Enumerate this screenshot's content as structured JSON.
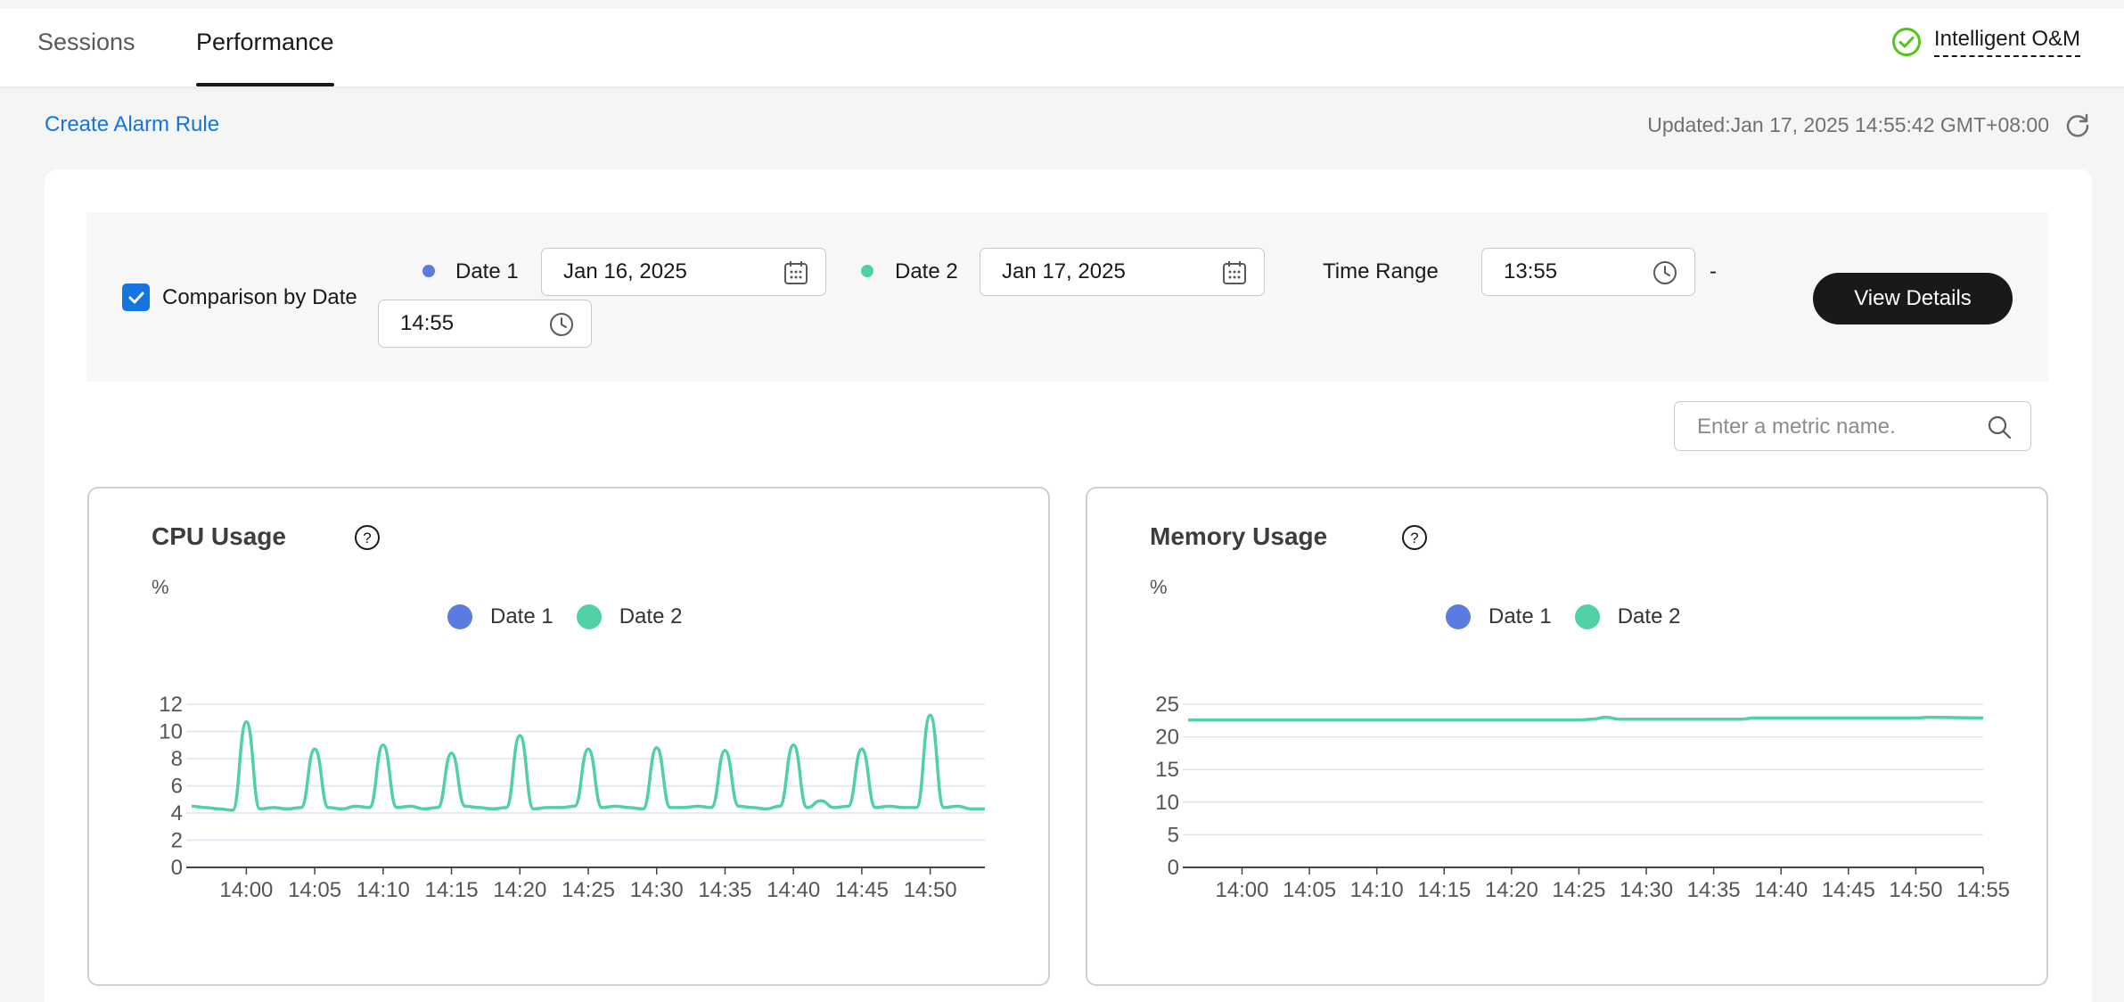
{
  "tabs": [
    {
      "label": "Sessions",
      "active": false
    },
    {
      "label": "Performance",
      "active": true
    }
  ],
  "om": {
    "label": "Intelligent O&M",
    "icon": "check-circle-icon",
    "color": "#52c41a"
  },
  "actions": {
    "create_alarm_rule": "Create Alarm Rule",
    "updated": "Updated:Jan 17, 2025 14:55:42 GMT+08:00",
    "refresh_icon": "refresh-icon"
  },
  "filter": {
    "comparison_label": "Comparison by Date",
    "comparison_checked": true,
    "date1_label": "Date 1",
    "date1_value": "Jan 16, 2025",
    "date2_label": "Date 2",
    "date2_value": "Jan 17, 2025",
    "time_range_label": "Time Range",
    "time_start": "13:55",
    "time_separator": "-",
    "time_end": "14:55",
    "view_details": "View Details"
  },
  "search": {
    "placeholder": "Enter a metric name.",
    "icon": "search-icon"
  },
  "colors": {
    "accent": "#1474e0",
    "date1": "#5b7be0",
    "date2": "#4fd1a5",
    "dark": "#191919"
  },
  "chart_data": [
    {
      "type": "line",
      "title": "CPU Usage",
      "unit": "%",
      "legend": [
        "Date 1",
        "Date 2"
      ],
      "ylim": [
        0,
        12
      ],
      "yticks": [
        0,
        2,
        4,
        6,
        8,
        10,
        12
      ],
      "x_range": [
        "13:56",
        "14:54"
      ],
      "xticks": [
        "14:00",
        "14:05",
        "14:10",
        "14:15",
        "14:20",
        "14:25",
        "14:30",
        "14:35",
        "14:40",
        "14:45",
        "14:50"
      ],
      "series": [
        {
          "name": "Date 2",
          "x": [
            "13:56",
            "13:57",
            "13:58",
            "13:59",
            "14:00",
            "14:01",
            "14:02",
            "14:03",
            "14:04",
            "14:05",
            "14:06",
            "14:07",
            "14:08",
            "14:09",
            "14:10",
            "14:11",
            "14:12",
            "14:13",
            "14:14",
            "14:15",
            "14:16",
            "14:17",
            "14:18",
            "14:19",
            "14:20",
            "14:21",
            "14:22",
            "14:23",
            "14:24",
            "14:25",
            "14:26",
            "14:27",
            "14:28",
            "14:29",
            "14:30",
            "14:31",
            "14:32",
            "14:33",
            "14:34",
            "14:35",
            "14:36",
            "14:37",
            "14:38",
            "14:39",
            "14:40",
            "14:41",
            "14:42",
            "14:43",
            "14:44",
            "14:45",
            "14:46",
            "14:47",
            "14:48",
            "14:49",
            "14:50",
            "14:51",
            "14:52",
            "14:53",
            "14:54"
          ],
          "values": [
            4.5,
            4.4,
            4.3,
            4.2,
            10.7,
            4.3,
            4.4,
            4.3,
            4.4,
            8.7,
            4.4,
            4.3,
            4.5,
            4.4,
            9.0,
            4.4,
            4.5,
            4.3,
            4.4,
            8.4,
            4.5,
            4.4,
            4.3,
            4.4,
            9.7,
            4.3,
            4.4,
            4.4,
            4.5,
            8.7,
            4.4,
            4.5,
            4.4,
            4.3,
            8.8,
            4.4,
            4.4,
            4.5,
            4.4,
            8.6,
            4.5,
            4.4,
            4.3,
            4.5,
            9.0,
            4.4,
            4.9,
            4.4,
            4.5,
            8.7,
            4.4,
            4.5,
            4.4,
            4.4,
            11.2,
            4.4,
            4.5,
            4.3,
            4.3
          ]
        }
      ]
    },
    {
      "type": "line",
      "title": "Memory Usage",
      "unit": "%",
      "legend": [
        "Date 1",
        "Date 2"
      ],
      "ylim": [
        0,
        25
      ],
      "yticks": [
        0,
        5,
        10,
        15,
        20,
        25
      ],
      "x_range": [
        "13:56",
        "14:55"
      ],
      "xticks": [
        "14:00",
        "14:05",
        "14:10",
        "14:15",
        "14:20",
        "14:25",
        "14:30",
        "14:35",
        "14:40",
        "14:45",
        "14:50",
        "14:55"
      ],
      "series": [
        {
          "name": "Date 2",
          "x": [
            "13:56",
            "14:00",
            "14:05",
            "14:10",
            "14:15",
            "14:20",
            "14:25",
            "14:26",
            "14:27",
            "14:28",
            "14:30",
            "14:35",
            "14:37",
            "14:38",
            "14:40",
            "14:45",
            "14:50",
            "14:51",
            "14:55"
          ],
          "values": [
            22.6,
            22.6,
            22.6,
            22.6,
            22.6,
            22.6,
            22.6,
            22.7,
            23.0,
            22.7,
            22.7,
            22.7,
            22.7,
            22.9,
            22.9,
            22.9,
            22.9,
            23.0,
            22.9
          ]
        }
      ]
    }
  ]
}
